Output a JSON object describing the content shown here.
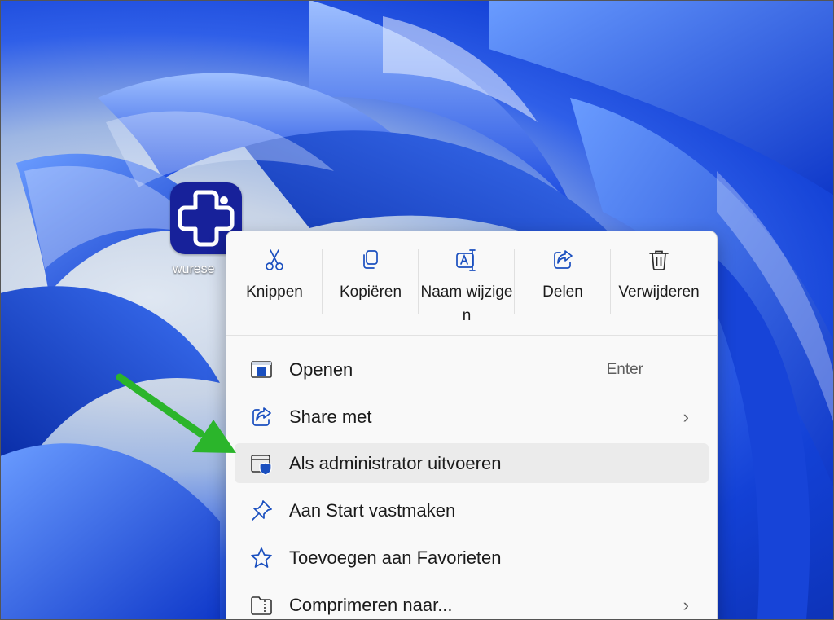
{
  "desktop": {
    "icon": {
      "name": "wurese",
      "icon": "medical-cross-app-icon",
      "color": "#17219a"
    }
  },
  "context_menu": {
    "quick_actions": [
      {
        "label": "Knippen",
        "icon": "scissors-icon"
      },
      {
        "label": "Kopiëren",
        "icon": "copy-icon"
      },
      {
        "label": "Naam wijzigen",
        "icon": "rename-icon"
      },
      {
        "label": "Delen",
        "icon": "share-icon"
      },
      {
        "label": "Verwijderen",
        "icon": "trash-icon"
      }
    ],
    "items": [
      {
        "label": "Openen",
        "shortcut": "Enter",
        "icon": "open-window-icon",
        "has_submenu": false
      },
      {
        "label": "Share met",
        "shortcut": "",
        "icon": "share-with-icon",
        "has_submenu": true
      },
      {
        "label": "Als administrator uitvoeren",
        "shortcut": "",
        "icon": "admin-shield-icon",
        "has_submenu": false,
        "highlighted": true
      },
      {
        "label": "Aan Start vastmaken",
        "shortcut": "",
        "icon": "pin-icon",
        "has_submenu": false
      },
      {
        "label": "Toevoegen aan Favorieten",
        "shortcut": "",
        "icon": "star-icon",
        "has_submenu": false
      },
      {
        "label": "Comprimeren naar...",
        "shortcut": "",
        "icon": "zip-folder-icon",
        "has_submenu": true
      }
    ],
    "submenu_chevron": "›"
  },
  "annotation": {
    "arrow_color": "#2bb52b",
    "points_to": "Als administrator uitvoeren"
  },
  "colors": {
    "accent": "#1a5fd0",
    "menu_bg": "#f9f9f9",
    "hover_bg": "#ebebeb"
  }
}
